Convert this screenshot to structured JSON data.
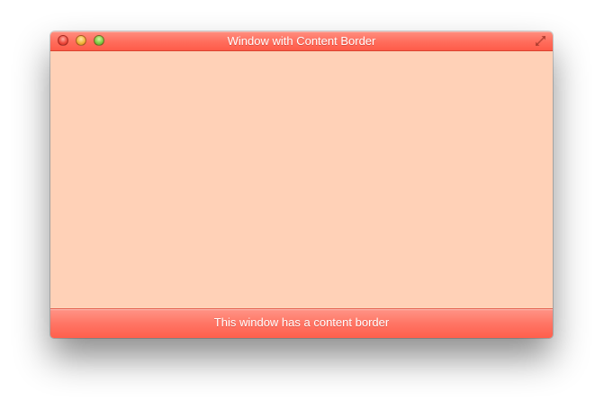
{
  "window": {
    "title": "Window with Content Border",
    "status_text": "This window has a content border"
  },
  "controls": {
    "close": "close-button",
    "minimize": "minimize-button",
    "zoom": "zoom-button",
    "fullscreen": "fullscreen-icon"
  },
  "colors": {
    "titlebar": "#ff6d5c",
    "content": "#ffd1b7",
    "bottombar": "#ff7565",
    "text": "#ffffff"
  }
}
